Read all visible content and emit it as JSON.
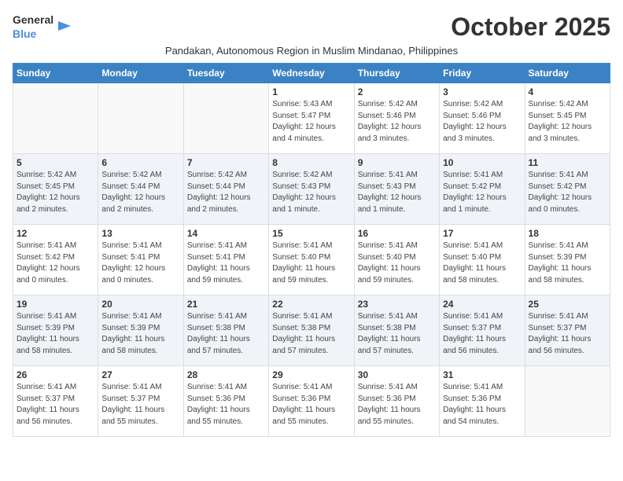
{
  "header": {
    "logo_general": "General",
    "logo_blue": "Blue",
    "month_title": "October 2025",
    "subtitle": "Pandakan, Autonomous Region in Muslim Mindanao, Philippines"
  },
  "weekdays": [
    "Sunday",
    "Monday",
    "Tuesday",
    "Wednesday",
    "Thursday",
    "Friday",
    "Saturday"
  ],
  "weeks": [
    [
      {
        "day": "",
        "info": ""
      },
      {
        "day": "",
        "info": ""
      },
      {
        "day": "",
        "info": ""
      },
      {
        "day": "1",
        "info": "Sunrise: 5:43 AM\nSunset: 5:47 PM\nDaylight: 12 hours\nand 4 minutes."
      },
      {
        "day": "2",
        "info": "Sunrise: 5:42 AM\nSunset: 5:46 PM\nDaylight: 12 hours\nand 3 minutes."
      },
      {
        "day": "3",
        "info": "Sunrise: 5:42 AM\nSunset: 5:46 PM\nDaylight: 12 hours\nand 3 minutes."
      },
      {
        "day": "4",
        "info": "Sunrise: 5:42 AM\nSunset: 5:45 PM\nDaylight: 12 hours\nand 3 minutes."
      }
    ],
    [
      {
        "day": "5",
        "info": "Sunrise: 5:42 AM\nSunset: 5:45 PM\nDaylight: 12 hours\nand 2 minutes."
      },
      {
        "day": "6",
        "info": "Sunrise: 5:42 AM\nSunset: 5:44 PM\nDaylight: 12 hours\nand 2 minutes."
      },
      {
        "day": "7",
        "info": "Sunrise: 5:42 AM\nSunset: 5:44 PM\nDaylight: 12 hours\nand 2 minutes."
      },
      {
        "day": "8",
        "info": "Sunrise: 5:42 AM\nSunset: 5:43 PM\nDaylight: 12 hours\nand 1 minute."
      },
      {
        "day": "9",
        "info": "Sunrise: 5:41 AM\nSunset: 5:43 PM\nDaylight: 12 hours\nand 1 minute."
      },
      {
        "day": "10",
        "info": "Sunrise: 5:41 AM\nSunset: 5:42 PM\nDaylight: 12 hours\nand 1 minute."
      },
      {
        "day": "11",
        "info": "Sunrise: 5:41 AM\nSunset: 5:42 PM\nDaylight: 12 hours\nand 0 minutes."
      }
    ],
    [
      {
        "day": "12",
        "info": "Sunrise: 5:41 AM\nSunset: 5:42 PM\nDaylight: 12 hours\nand 0 minutes."
      },
      {
        "day": "13",
        "info": "Sunrise: 5:41 AM\nSunset: 5:41 PM\nDaylight: 12 hours\nand 0 minutes."
      },
      {
        "day": "14",
        "info": "Sunrise: 5:41 AM\nSunset: 5:41 PM\nDaylight: 11 hours\nand 59 minutes."
      },
      {
        "day": "15",
        "info": "Sunrise: 5:41 AM\nSunset: 5:40 PM\nDaylight: 11 hours\nand 59 minutes."
      },
      {
        "day": "16",
        "info": "Sunrise: 5:41 AM\nSunset: 5:40 PM\nDaylight: 11 hours\nand 59 minutes."
      },
      {
        "day": "17",
        "info": "Sunrise: 5:41 AM\nSunset: 5:40 PM\nDaylight: 11 hours\nand 58 minutes."
      },
      {
        "day": "18",
        "info": "Sunrise: 5:41 AM\nSunset: 5:39 PM\nDaylight: 11 hours\nand 58 minutes."
      }
    ],
    [
      {
        "day": "19",
        "info": "Sunrise: 5:41 AM\nSunset: 5:39 PM\nDaylight: 11 hours\nand 58 minutes."
      },
      {
        "day": "20",
        "info": "Sunrise: 5:41 AM\nSunset: 5:39 PM\nDaylight: 11 hours\nand 58 minutes."
      },
      {
        "day": "21",
        "info": "Sunrise: 5:41 AM\nSunset: 5:38 PM\nDaylight: 11 hours\nand 57 minutes."
      },
      {
        "day": "22",
        "info": "Sunrise: 5:41 AM\nSunset: 5:38 PM\nDaylight: 11 hours\nand 57 minutes."
      },
      {
        "day": "23",
        "info": "Sunrise: 5:41 AM\nSunset: 5:38 PM\nDaylight: 11 hours\nand 57 minutes."
      },
      {
        "day": "24",
        "info": "Sunrise: 5:41 AM\nSunset: 5:37 PM\nDaylight: 11 hours\nand 56 minutes."
      },
      {
        "day": "25",
        "info": "Sunrise: 5:41 AM\nSunset: 5:37 PM\nDaylight: 11 hours\nand 56 minutes."
      }
    ],
    [
      {
        "day": "26",
        "info": "Sunrise: 5:41 AM\nSunset: 5:37 PM\nDaylight: 11 hours\nand 56 minutes."
      },
      {
        "day": "27",
        "info": "Sunrise: 5:41 AM\nSunset: 5:37 PM\nDaylight: 11 hours\nand 55 minutes."
      },
      {
        "day": "28",
        "info": "Sunrise: 5:41 AM\nSunset: 5:36 PM\nDaylight: 11 hours\nand 55 minutes."
      },
      {
        "day": "29",
        "info": "Sunrise: 5:41 AM\nSunset: 5:36 PM\nDaylight: 11 hours\nand 55 minutes."
      },
      {
        "day": "30",
        "info": "Sunrise: 5:41 AM\nSunset: 5:36 PM\nDaylight: 11 hours\nand 55 minutes."
      },
      {
        "day": "31",
        "info": "Sunrise: 5:41 AM\nSunset: 5:36 PM\nDaylight: 11 hours\nand 54 minutes."
      },
      {
        "day": "",
        "info": ""
      }
    ]
  ]
}
